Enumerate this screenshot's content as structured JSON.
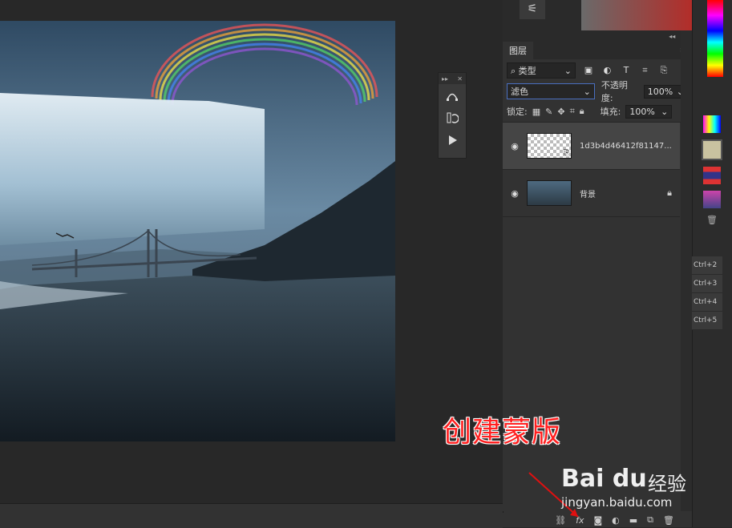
{
  "layers_panel": {
    "tab_label": "图层",
    "filter": {
      "kind_label": "类型",
      "icons": [
        "image-filter-icon",
        "adjustment-filter-icon",
        "type-filter-icon",
        "shape-filter-icon",
        "smart-object-filter-icon"
      ]
    },
    "blend_mode": "滤色",
    "opacity_label": "不透明度:",
    "opacity_value": "100%",
    "lock_label": "锁定:",
    "fill_label": "填充:",
    "fill_value": "100%",
    "layers": [
      {
        "name": "1d3b4d46412f81147...",
        "selected": true
      },
      {
        "name": "背景",
        "locked": true
      }
    ]
  },
  "shortcuts": [
    "Ctrl+2",
    "Ctrl+3",
    "Ctrl+4",
    "Ctrl+5"
  ],
  "annotation": {
    "caption": "创建蒙版"
  },
  "watermark": {
    "logo_text": "Bai du",
    "suffix": "经验",
    "url": "jingyan.baidu.com"
  },
  "colors": {
    "caption": "#ff2020",
    "selected_layer": "#454545",
    "panel_bg": "#323232"
  }
}
